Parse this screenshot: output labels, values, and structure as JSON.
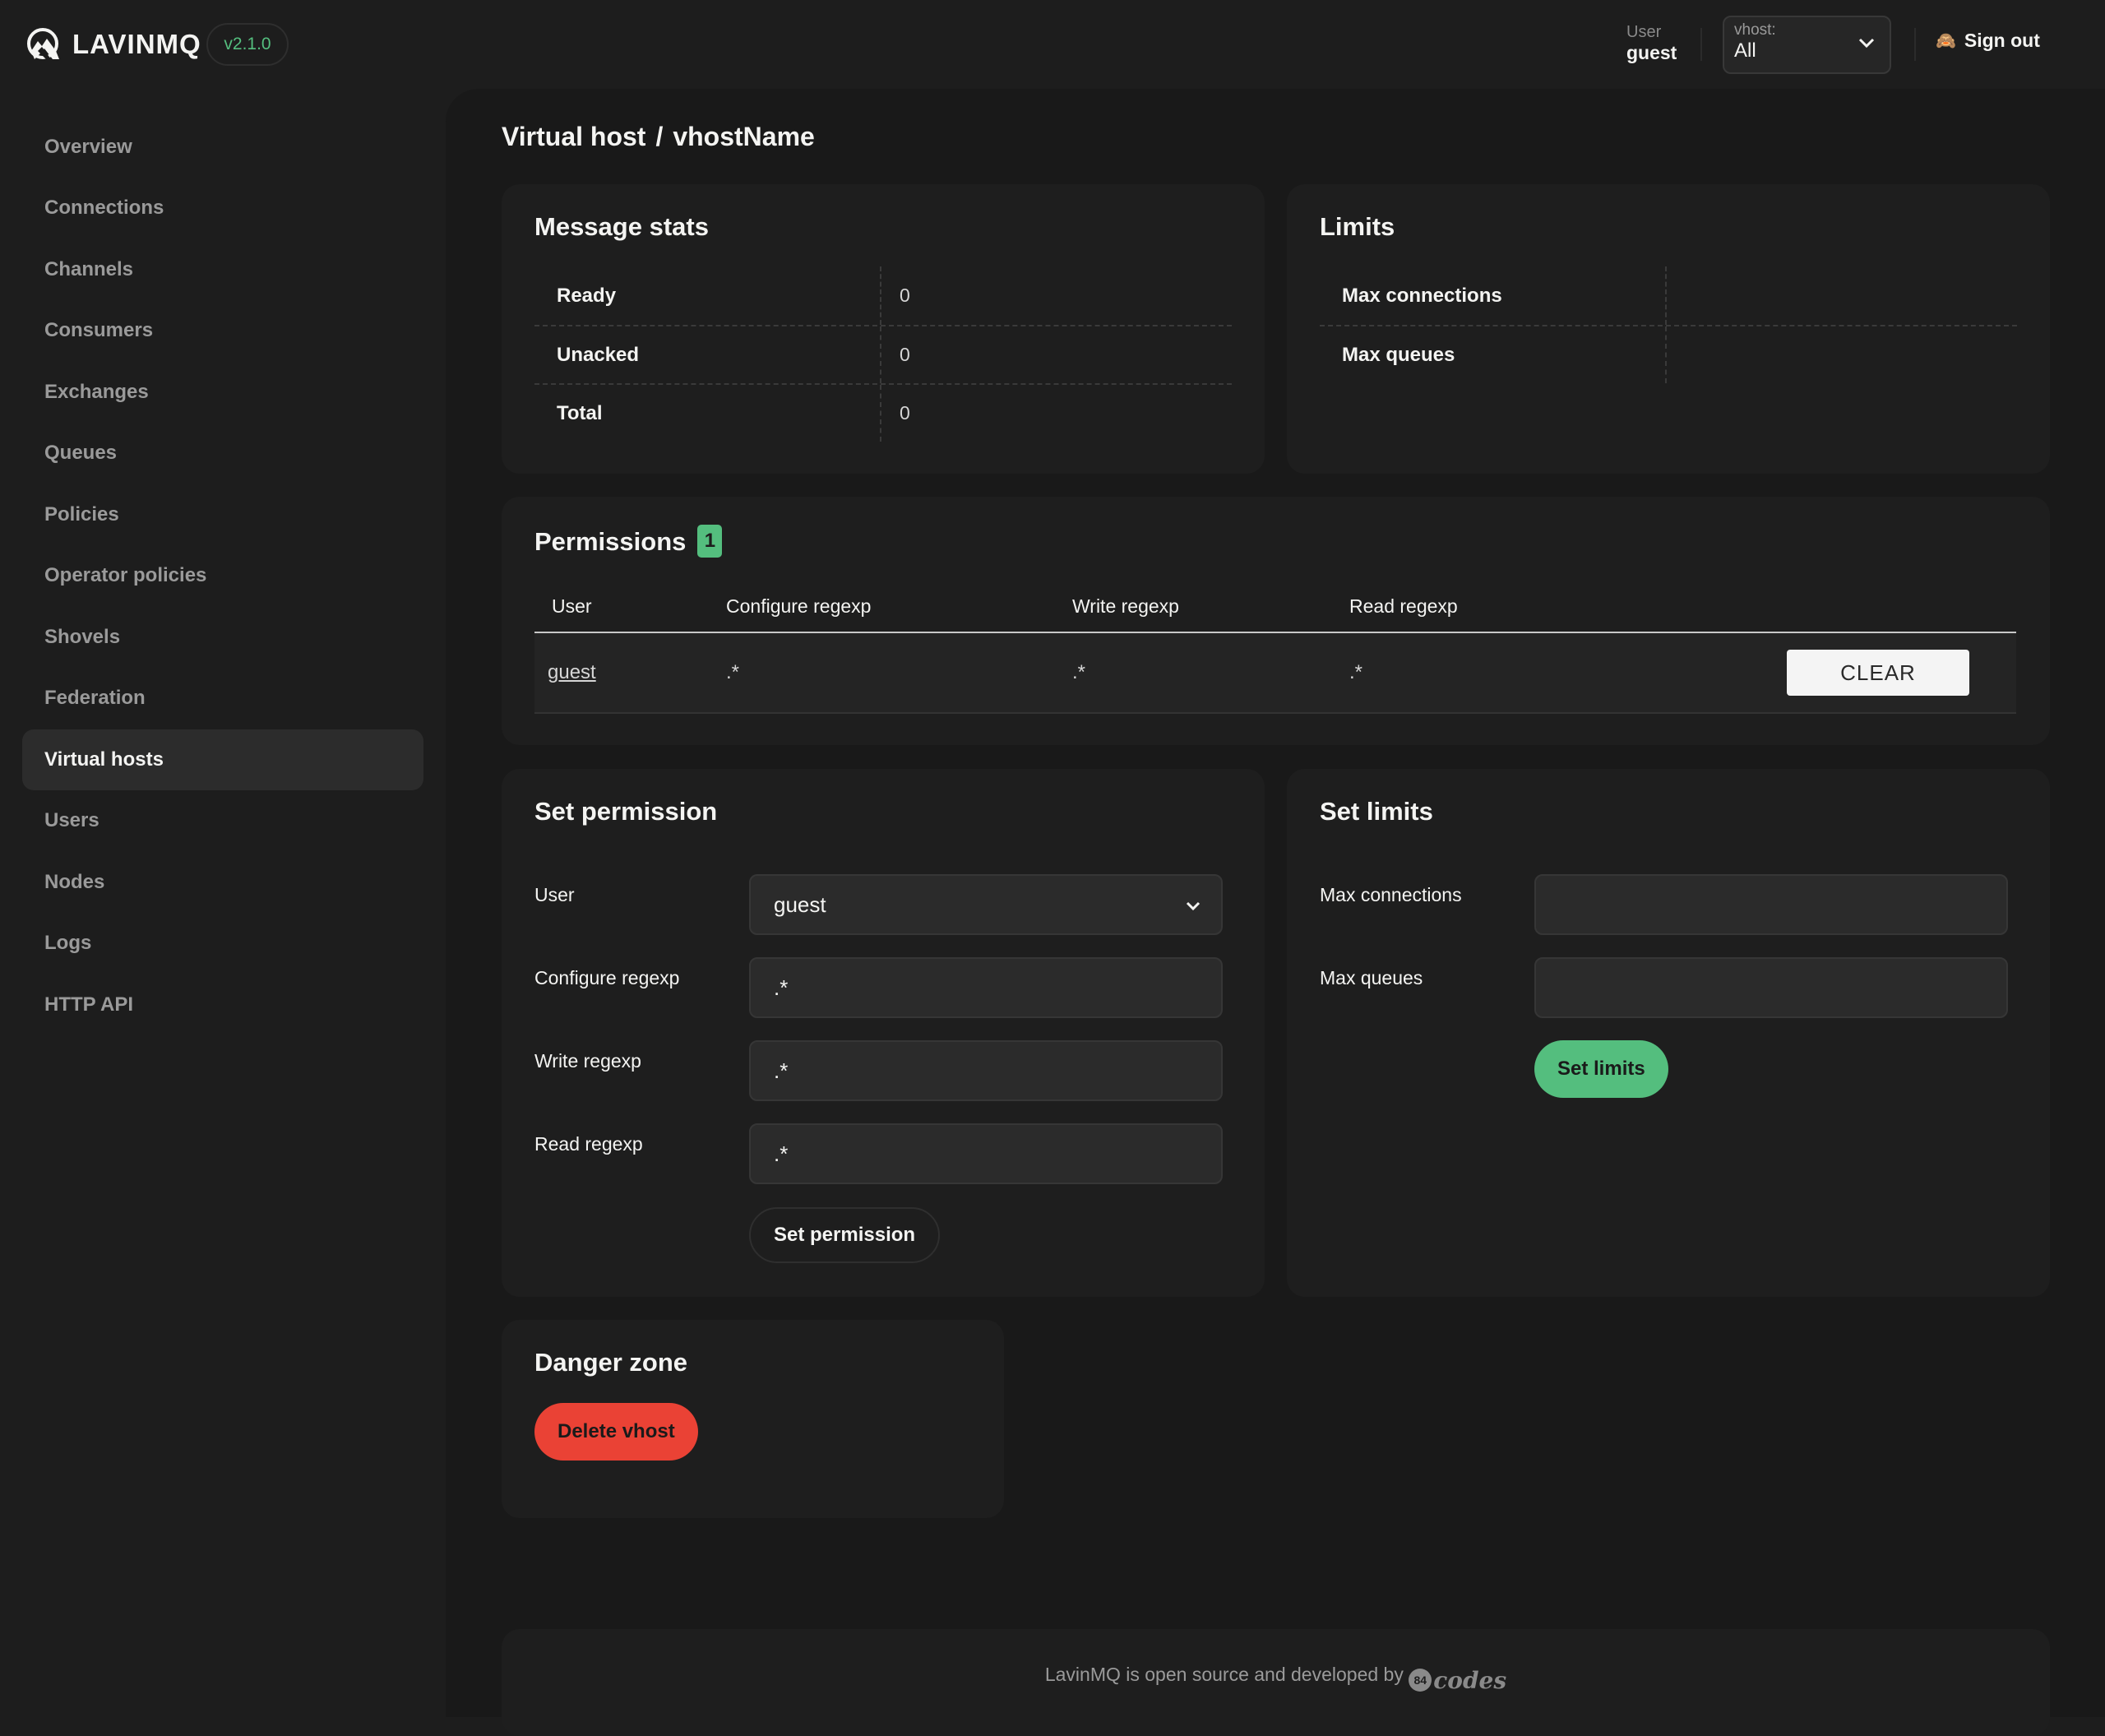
{
  "header": {
    "brand": "LAVINMQ",
    "version": "v2.1.0",
    "user_label": "User",
    "user_name": "guest",
    "vhost_label": "vhost:",
    "vhost_value": "All",
    "signout_icon": "🙈",
    "signout_label": "Sign out"
  },
  "sidebar": {
    "items": [
      {
        "label": "Overview"
      },
      {
        "label": "Connections"
      },
      {
        "label": "Channels"
      },
      {
        "label": "Consumers"
      },
      {
        "label": "Exchanges"
      },
      {
        "label": "Queues"
      },
      {
        "label": "Policies"
      },
      {
        "label": "Operator policies"
      },
      {
        "label": "Shovels"
      },
      {
        "label": "Federation"
      },
      {
        "label": "Virtual hosts",
        "active": true
      },
      {
        "label": "Users"
      },
      {
        "label": "Nodes"
      },
      {
        "label": "Logs"
      },
      {
        "label": "HTTP API"
      }
    ]
  },
  "page": {
    "breadcrumb_parent": "Virtual host",
    "breadcrumb_separator": "/",
    "breadcrumb_current": "vhostName"
  },
  "message_stats": {
    "title": "Message stats",
    "rows": [
      {
        "key": "Ready",
        "value": "0"
      },
      {
        "key": "Unacked",
        "value": "0"
      },
      {
        "key": "Total",
        "value": "0"
      }
    ]
  },
  "limits": {
    "title": "Limits",
    "rows": [
      {
        "key": "Max connections",
        "value": ""
      },
      {
        "key": "Max queues",
        "value": ""
      }
    ]
  },
  "permissions": {
    "title": "Permissions",
    "count": "1",
    "columns": [
      "User",
      "Configure regexp",
      "Write regexp",
      "Read regexp"
    ],
    "rows": [
      {
        "user": "guest",
        "configure": ".*",
        "write": ".*",
        "read": ".*",
        "action": "CLEAR"
      }
    ]
  },
  "set_permission": {
    "title": "Set permission",
    "user_label": "User",
    "user_value": "guest",
    "configure_label": "Configure regexp",
    "configure_value": ".*",
    "write_label": "Write regexp",
    "write_value": ".*",
    "read_label": "Read regexp",
    "read_value": ".*",
    "submit_label": "Set permission"
  },
  "set_limits": {
    "title": "Set limits",
    "max_connections_label": "Max connections",
    "max_connections_value": "",
    "max_queues_label": "Max queues",
    "max_queues_value": "",
    "submit_label": "Set limits"
  },
  "danger_zone": {
    "title": "Danger zone",
    "delete_label": "Delete vhost"
  },
  "footer": {
    "text": "LavinMQ is open source and developed by",
    "logo_number": "84",
    "logo_word": "codes"
  },
  "colors": {
    "accent_green": "#54be7e",
    "danger_red": "#ea4235"
  }
}
